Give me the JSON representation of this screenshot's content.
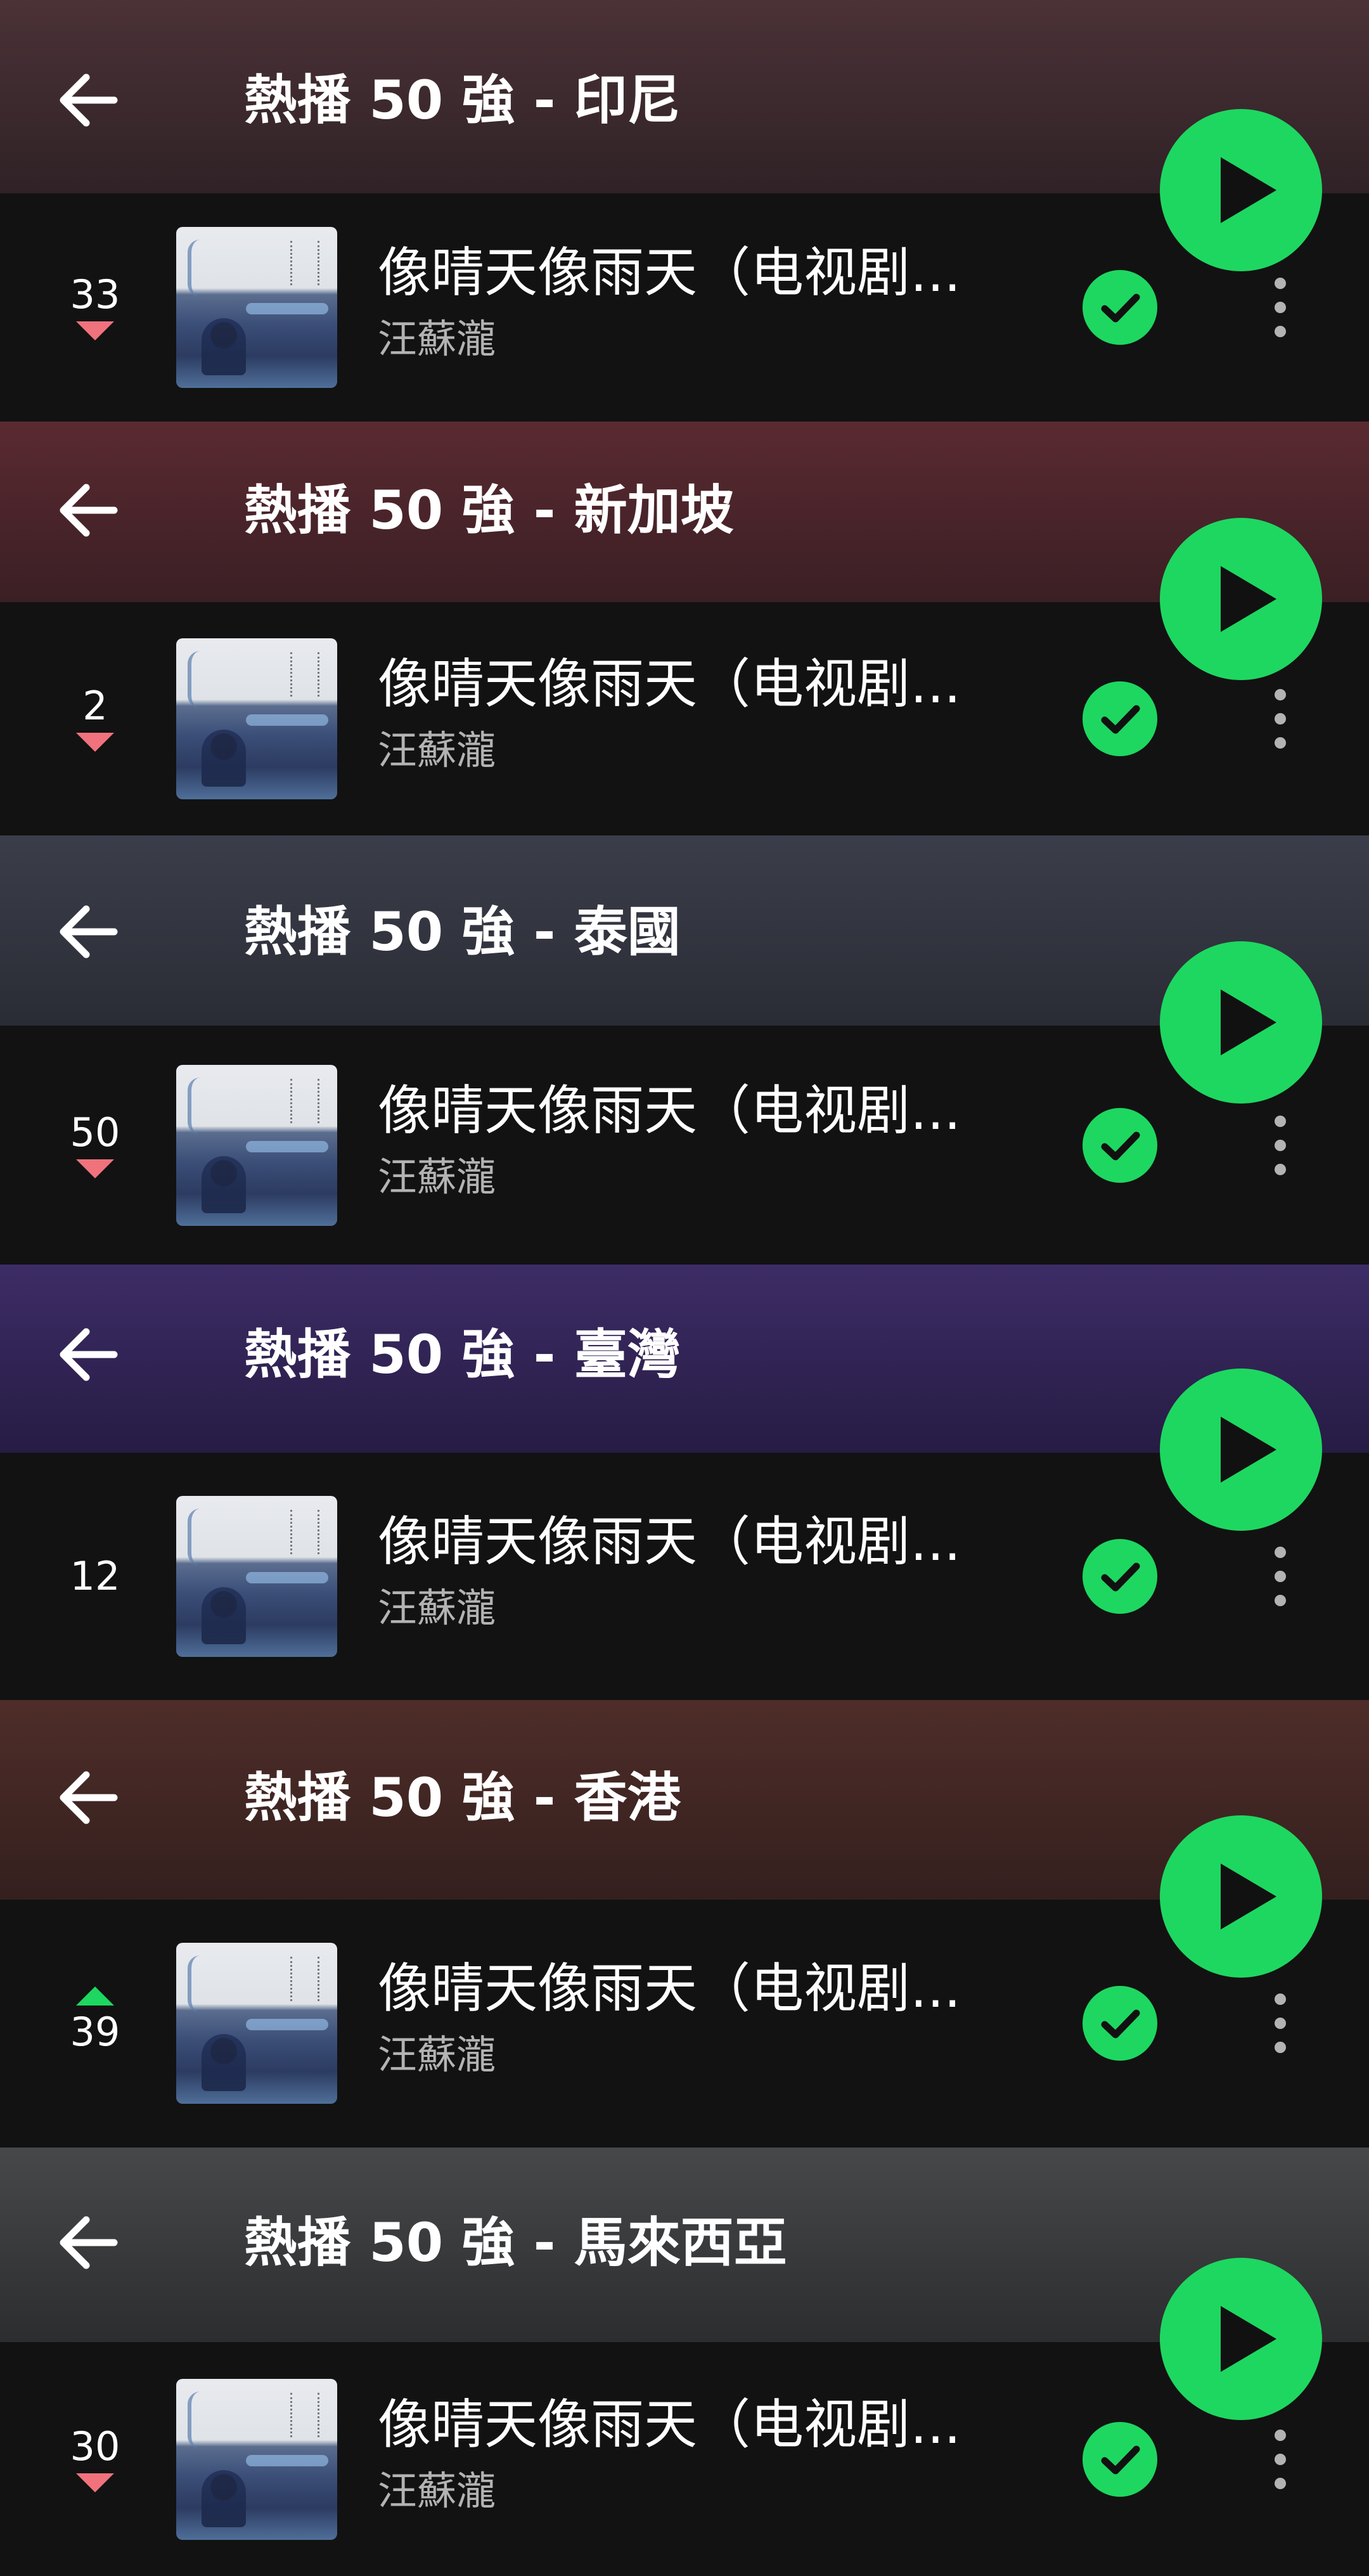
{
  "sections": [
    {
      "title": "熱播 50 強 - 印尼",
      "header_colors": [
        "#4b3237",
        "#2f2226"
      ],
      "rank": "33",
      "trend": "down",
      "song": "像晴天像雨天（电视剧...",
      "artist": "汪蘇瀧"
    },
    {
      "title": "熱播 50 強 - 新加坡",
      "header_colors": [
        "#5a2a31",
        "#3a1f24"
      ],
      "rank": "2",
      "trend": "down",
      "song": "像晴天像雨天（电视剧...",
      "artist": "汪蘇瀧"
    },
    {
      "title": "熱播 50 強 - 泰國",
      "header_colors": [
        "#3b3e4a",
        "#2a2c35"
      ],
      "rank": "50",
      "trend": "down",
      "song": "像晴天像雨天（电视剧...",
      "artist": "汪蘇瀧"
    },
    {
      "title": "熱播 50 強 - 臺灣",
      "header_colors": [
        "#3d2c66",
        "#261c44"
      ],
      "rank": "12",
      "trend": "none",
      "song": "像晴天像雨天（电视剧...",
      "artist": "汪蘇瀧"
    },
    {
      "title": "熱播 50 強 - 香港",
      "header_colors": [
        "#4f2d29",
        "#33201e"
      ],
      "rank": "39",
      "trend": "up",
      "song": "像晴天像雨天（电视剧...",
      "artist": "汪蘇瀧"
    },
    {
      "title": "熱播 50 強 - 馬來西亞",
      "header_colors": [
        "#464849",
        "#2c2d2f"
      ],
      "rank": "30",
      "trend": "down",
      "song": "像晴天像雨天（电视剧...",
      "artist": "汪蘇瀧"
    }
  ],
  "colors": {
    "accent_green": "#1ed760",
    "trend_down": "#f0727d",
    "trend_up": "#1ed760",
    "background": "#121212"
  },
  "icons": {
    "back": "arrow-left-icon",
    "downloaded": "check-circle-icon",
    "more": "more-vertical-icon",
    "play": "play-icon"
  }
}
